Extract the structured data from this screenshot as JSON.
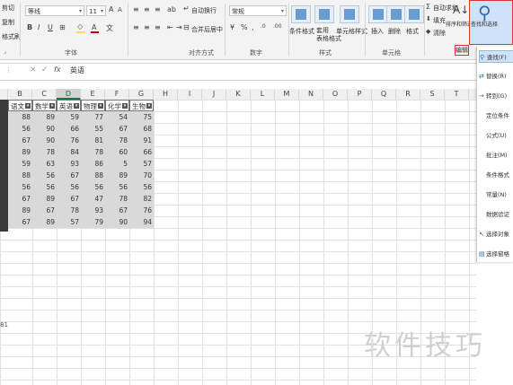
{
  "ribbon": {
    "clipboard": {
      "cut": "剪切",
      "copy": "复制",
      "format_painter": "格式刷",
      "label": ""
    },
    "font": {
      "name": "等线",
      "size": "11",
      "bold": "B",
      "italic": "I",
      "underline": "U",
      "label": "字体",
      "font_color": "#c00000",
      "fill_color": "#ffd966"
    },
    "alignment": {
      "wrap": "自动换行",
      "merge": "合并后居中",
      "label": "对齐方式"
    },
    "number": {
      "format": "常规",
      "label": "数字"
    },
    "styles": {
      "conditional": "条件格式",
      "table": "套用\n表格格式",
      "cell": "单元格样式",
      "label": "样式"
    },
    "cells": {
      "insert": "插入",
      "delete": "删除",
      "format": "格式",
      "label": "单元格"
    },
    "editing": {
      "autosum": "自动求和",
      "fill": "填充",
      "clear": "清除",
      "sort": "排序和筛选",
      "find": "查找和选择",
      "label": "编辑"
    }
  },
  "formula_bar": {
    "name_box": "",
    "cancel": "×",
    "enter": "✓",
    "fx": "fx",
    "value": "英语"
  },
  "columns": [
    "B",
    "C",
    "D",
    "E",
    "F",
    "G",
    "H",
    "I",
    "J",
    "K",
    "L",
    "M",
    "N",
    "O",
    "P",
    "Q",
    "R",
    "S",
    "T"
  ],
  "selected_column": "D",
  "table": {
    "headers": [
      "语文",
      "数学",
      "英语",
      "物理",
      "化学",
      "生物"
    ],
    "rows": [
      [
        "88",
        "89",
        "59",
        "77",
        "54",
        "75"
      ],
      [
        "56",
        "90",
        "66",
        "55",
        "67",
        "68"
      ],
      [
        "67",
        "90",
        "76",
        "81",
        "78",
        "91"
      ],
      [
        "89",
        "78",
        "84",
        "78",
        "60",
        "66"
      ],
      [
        "59",
        "63",
        "93",
        "86",
        "5",
        "57"
      ],
      [
        "88",
        "56",
        "67",
        "88",
        "89",
        "70"
      ],
      [
        "56",
        "56",
        "56",
        "56",
        "56",
        "56"
      ],
      [
        "67",
        "89",
        "67",
        "47",
        "78",
        "82"
      ],
      [
        "89",
        "67",
        "78",
        "93",
        "67",
        "76"
      ],
      [
        "67",
        "89",
        "57",
        "79",
        "90",
        "94"
      ]
    ]
  },
  "side_label": "81",
  "menu": {
    "items": [
      {
        "icon": "search",
        "label": "查找(F)"
      },
      {
        "icon": "replace",
        "label": "替换(R)"
      },
      {
        "icon": "arrow",
        "label": "转到(G)"
      },
      {
        "icon": "",
        "label": "定位条件"
      },
      {
        "icon": "",
        "label": "公式(U)"
      },
      {
        "icon": "",
        "label": "批注(M)"
      },
      {
        "icon": "",
        "label": "条件格式"
      },
      {
        "icon": "",
        "label": "常量(N)"
      },
      {
        "icon": "",
        "label": "数据验证"
      },
      {
        "icon": "cursor",
        "label": "选择对象"
      },
      {
        "icon": "pane",
        "label": "选择窗格"
      }
    ]
  },
  "watermark": "软件技巧"
}
